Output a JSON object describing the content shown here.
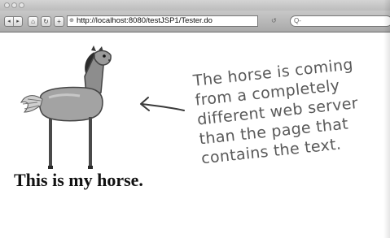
{
  "browser": {
    "url": "http://localhost:8080/testJSP1/Tester.do",
    "nav": {
      "back_label": "◂",
      "forward_label": "▸",
      "home_label": "⌂",
      "reload_label": "↻",
      "add_label": "+"
    },
    "search_placeholder": "Q-"
  },
  "page": {
    "caption": "This is my horse."
  },
  "annotation": {
    "lines": [
      "The horse is coming",
      "from a completely",
      "different web server",
      "than the page that",
      "contains the text."
    ]
  }
}
